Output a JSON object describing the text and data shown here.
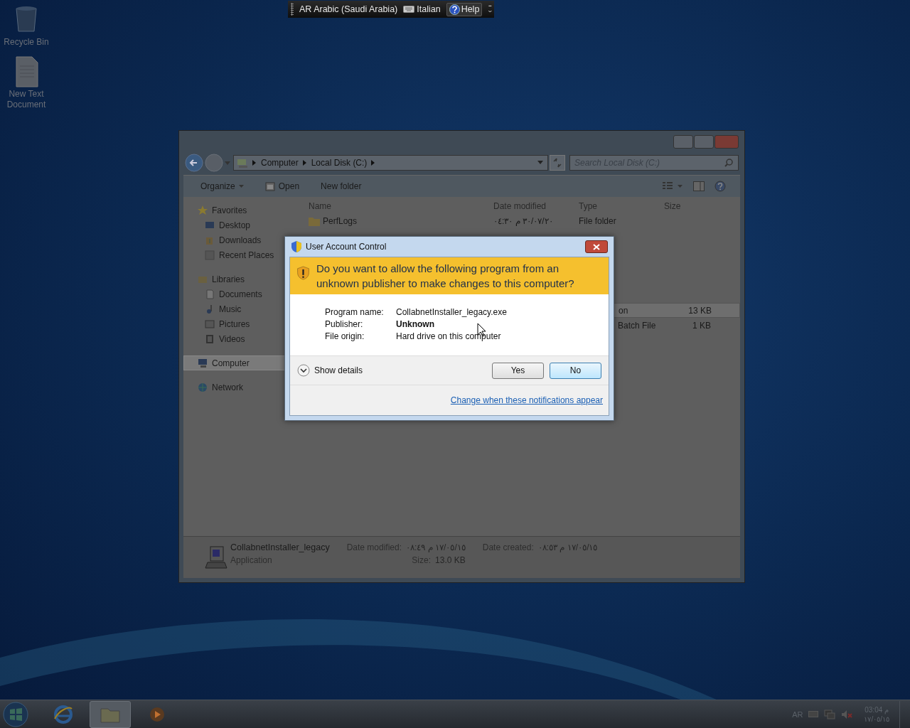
{
  "language_bar": {
    "language": "AR Arabic (Saudi Arabia)",
    "keyboard": "Italian",
    "help": "Help"
  },
  "desktop_icons": [
    {
      "kind": "bin",
      "label": "Recycle Bin"
    },
    {
      "kind": "file",
      "label": "New Text Document"
    }
  ],
  "explorer": {
    "breadcrumb": [
      "Computer",
      "Local Disk (C:)"
    ],
    "search": {
      "placeholder": "Search Local Disk (C:)"
    },
    "toolbar": [
      {
        "kind": "menu",
        "label": "Organize"
      },
      {
        "kind": "open",
        "label": "Open"
      },
      {
        "kind": "plain",
        "label": "New folder"
      }
    ],
    "nav": [
      {
        "kind": "star",
        "label": "Favorites",
        "selected": false,
        "children": [
          {
            "kind": "desktop",
            "label": "Desktop",
            "selected": false
          },
          {
            "kind": "download",
            "label": "Downloads",
            "selected": false
          },
          {
            "kind": "recent",
            "label": "Recent Places",
            "selected": false
          }
        ]
      },
      {
        "kind": "library",
        "label": "Libraries",
        "selected": false,
        "children": [
          {
            "kind": "doc",
            "label": "Documents",
            "selected": false
          },
          {
            "kind": "music",
            "label": "Music",
            "selected": false
          },
          {
            "kind": "picture",
            "label": "Pictures",
            "selected": false
          },
          {
            "kind": "video",
            "label": "Videos",
            "selected": false
          }
        ]
      },
      {
        "kind": "computer",
        "label": "Computer",
        "selected": true
      },
      {
        "kind": "network",
        "label": "Network",
        "selected": false
      }
    ],
    "columns": [
      "Name",
      "Date modified",
      "Type",
      "Size"
    ],
    "rows": [
      {
        "name": "PerfLogs",
        "date": "٣٠/٠٧/٢٠ م ٠٤:٣٠",
        "type": "File folder",
        "selected": false
      },
      {
        "type": "on",
        "size": "13 KB",
        "selected": true
      },
      {
        "type": "Batch File",
        "size": "1 KB",
        "selected": false
      }
    ],
    "details": {
      "name": "CollabnetInstaller_legacy",
      "kind": "Application",
      "modified_label": "Date modified:",
      "modified": "١٧/٠٥/١٥ م ٠٨:٤٩",
      "created_label": "Date created:",
      "created": "١٧/٠٥/١٥ م ٠٨:٥٣",
      "size_label": "Size:",
      "size": "13.0 KB"
    }
  },
  "dialog": {
    "title": "User Account Control",
    "question": "Do you want to allow the following program from an unknown publisher to make changes to this computer?",
    "fields": [
      {
        "label": "Program name:",
        "value": "CollabnetInstaller_legacy.exe",
        "bold": false
      },
      {
        "label": "Publisher:",
        "value": "Unknown",
        "bold": true
      },
      {
        "label": "File origin:",
        "value": "Hard drive on this computer",
        "bold": false
      }
    ],
    "details_toggle": {
      "label": "Show details",
      "expanded": false
    },
    "buttons": [
      {
        "label": "Yes",
        "selected": false
      },
      {
        "label": "No",
        "selected": true
      }
    ],
    "link": "Change when these notifications appear"
  },
  "taskbar": {
    "items": [
      {
        "kind": "browser",
        "selected": false
      },
      {
        "kind": "folder",
        "selected": true
      },
      {
        "kind": "media",
        "selected": false
      }
    ],
    "tray_language": "AR",
    "time": "03:04 م",
    "date": "١٧/٠٥/١٥"
  }
}
